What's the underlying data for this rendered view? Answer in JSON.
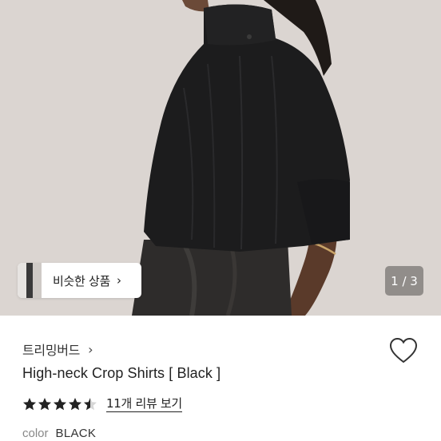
{
  "gallery": {
    "similar_products_label": "비슷한 상품",
    "similar_products_chevron": "›",
    "page_indicator": "1 / 3",
    "current_page": 1,
    "total_pages": 3
  },
  "product": {
    "brand": "트리밍버드",
    "brand_chevron": "›",
    "name": "High-neck Crop Shirts [ Black ]",
    "rating": 4.5,
    "rating_max": 5,
    "review_link": "11개 리뷰 보기",
    "color_label": "color",
    "color_value": "BLACK"
  },
  "icons": {
    "wishlist": "heart-outline-icon",
    "star": "star-icon"
  },
  "colors": {
    "text_primary": "#222222",
    "text_secondary": "#888888",
    "star_fill": "#222222",
    "indicator_bg": "#78746f"
  }
}
